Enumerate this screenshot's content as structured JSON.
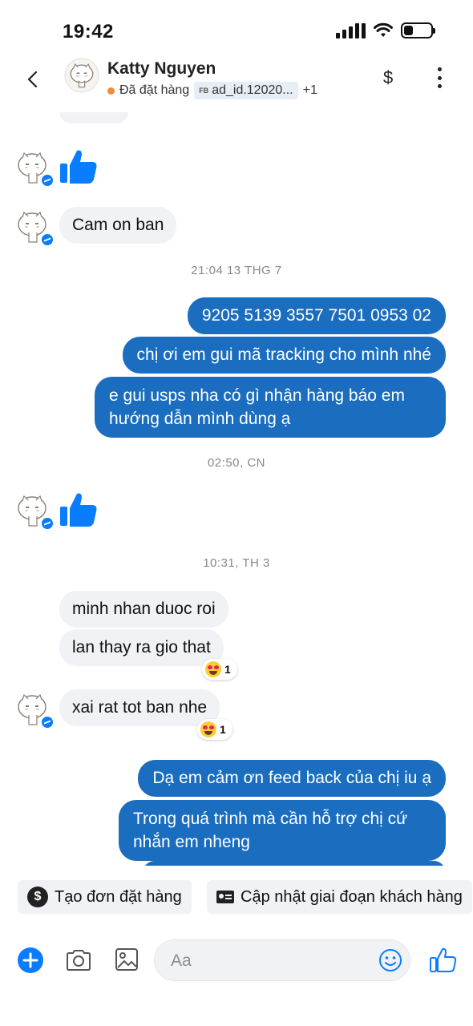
{
  "status_bar": {
    "time": "19:42",
    "battery_level": 0.35
  },
  "header": {
    "contact_name": "Katty Nguyen",
    "order_status": "Đã đặt hàng",
    "ad_badge": "FB",
    "ad_id": "ad_id.12020...",
    "extra_count": "+1",
    "dollar_icon": "$"
  },
  "messages": {
    "m1": "Cam on ban",
    "ts1": "21:04 13 THG 7",
    "o1": "9205 5139 3557 7501 0953 02",
    "o2": "chị ơi em gui mã tracking cho mình nhé",
    "o3": "e gui usps nha có gì nhận hàng báo em hướng dẫn mình dùng ạ",
    "ts2": "02:50, CN",
    "ts3": "10:31, TH 3",
    "m2": "minh nhan duoc roi",
    "m3": "lan thay ra gio that",
    "r1": "1",
    "m4": "xai rat tot ban nhe",
    "r2": "1",
    "o4": "Dạ em cảm ơn feed back của chị iu ạ",
    "o5": "Trong quá trình mà cần hỗ trợ chị cứ nhắn em nheng"
  },
  "quick_actions": {
    "create_order": "Tạo đơn đặt hàng",
    "dollar_icon": "$",
    "update_stage": "Cập nhật giai đoạn khách hàng"
  },
  "composer": {
    "placeholder": "Aa"
  },
  "colors": {
    "outgoing": "#1a6dbf",
    "incoming": "#f1f2f5",
    "accent": "#0a7cff"
  }
}
